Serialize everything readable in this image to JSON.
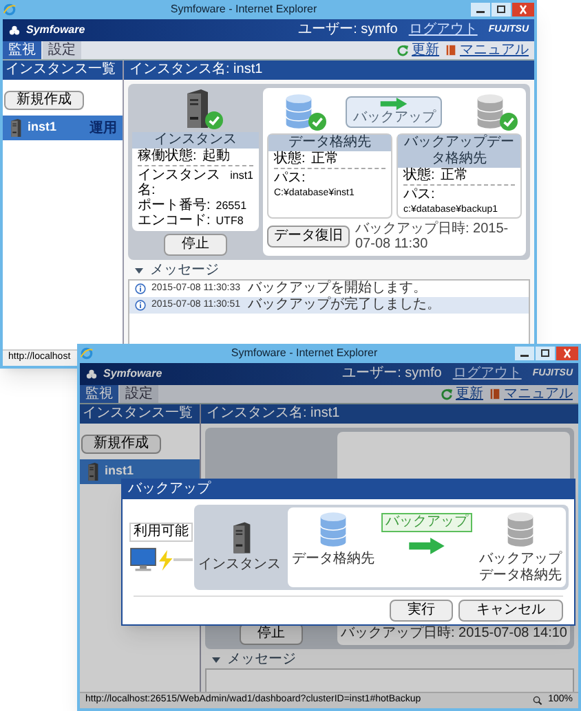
{
  "window_1": {
    "title": "Symfoware - Internet Explorer",
    "app_header": {
      "logo": "Symfoware",
      "user": "ユーザー: symfo",
      "logout": "ログアウト",
      "brand": "FUJITSU"
    },
    "tabs": [
      {
        "label": "監視",
        "selected": true
      },
      {
        "label": "設定",
        "selected": false
      }
    ],
    "links": [
      {
        "label": "更新",
        "kind": "refresh"
      },
      {
        "label": "マニュアル",
        "kind": "manual"
      }
    ],
    "sidebar": {
      "title": "インスタンス一覧",
      "new_button": "新規作成",
      "items": [
        {
          "name": "inst1",
          "badge": "運用",
          "selected": true
        }
      ]
    },
    "main": {
      "title": "インスタンス名: inst1",
      "instance": {
        "title": "インスタンス",
        "ok": true,
        "status_label": "稼働状態:",
        "status": "起動",
        "details": [
          {
            "label": "インスタンス名:",
            "value": "inst1"
          },
          {
            "label": "ポート番号:",
            "value": "26551"
          },
          {
            "label": "エンコード:",
            "value": "UTF8"
          }
        ],
        "button": "停止"
      },
      "storage": [
        {
          "kind": "data",
          "title": "データ格納先",
          "ok": true,
          "status_label": "状態:",
          "status": "正常",
          "path_label": "パス:",
          "path": "C:¥database¥inst1"
        },
        {
          "kind": "backup",
          "title": "バックアップデータ格納先",
          "ok": true,
          "status_label": "状態:",
          "status": "正常",
          "path_label": "パス:",
          "path": "c:¥database¥backup1"
        }
      ],
      "backup_button": "バックアップ",
      "restore_button": "データ復旧",
      "backup_time": "バックアップ日時: 2015-07-08 11:30"
    },
    "messages": {
      "title": "メッセージ",
      "rows": [
        {
          "time": "2015-07-08 11:30:33",
          "text": "バックアップを開始します。",
          "selected": false
        },
        {
          "time": "2015-07-08 11:30:51",
          "text": "バックアップが完了しました。",
          "selected": true
        }
      ]
    },
    "status_bar": {
      "url": "http://localhost"
    }
  },
  "window_2": {
    "title": "Symfoware - Internet Explorer",
    "app_header": {
      "logo": "Symfoware",
      "user": "ユーザー: symfo",
      "logout": "ログアウト",
      "brand": "FUJITSU"
    },
    "tabs": [
      {
        "label": "監視",
        "selected": true
      },
      {
        "label": "設定",
        "selected": false
      }
    ],
    "links": [
      {
        "label": "更新",
        "kind": "refresh"
      },
      {
        "label": "マニュアル",
        "kind": "manual"
      }
    ],
    "sidebar": {
      "title": "インスタンス一覧",
      "new_button": "新規作成",
      "items": [
        {
          "name": "inst1",
          "selected": true
        }
      ]
    },
    "main": {
      "title": "インスタンス名: inst1",
      "stop_button": "停止",
      "backup_time": "バックアップ日時: 2015-07-08 14:10"
    },
    "messages": {
      "title": "メッセージ"
    },
    "dialog": {
      "title": "バックアップ",
      "connection_label": "利用可能",
      "action_label": "バックアップ",
      "nodes": [
        {
          "kind": "server",
          "label": "インスタンス"
        },
        {
          "kind": "data",
          "label": "データ格納先"
        },
        {
          "kind": "backup",
          "label": "バックアップデータ格納先"
        }
      ],
      "buttons": [
        "実行",
        "キャンセル"
      ]
    },
    "status_bar": {
      "url": "http://localhost:26515/WebAdmin/wad1/dashboard?clusterID=inst1#hotBackup",
      "zoom": "100%"
    }
  }
}
